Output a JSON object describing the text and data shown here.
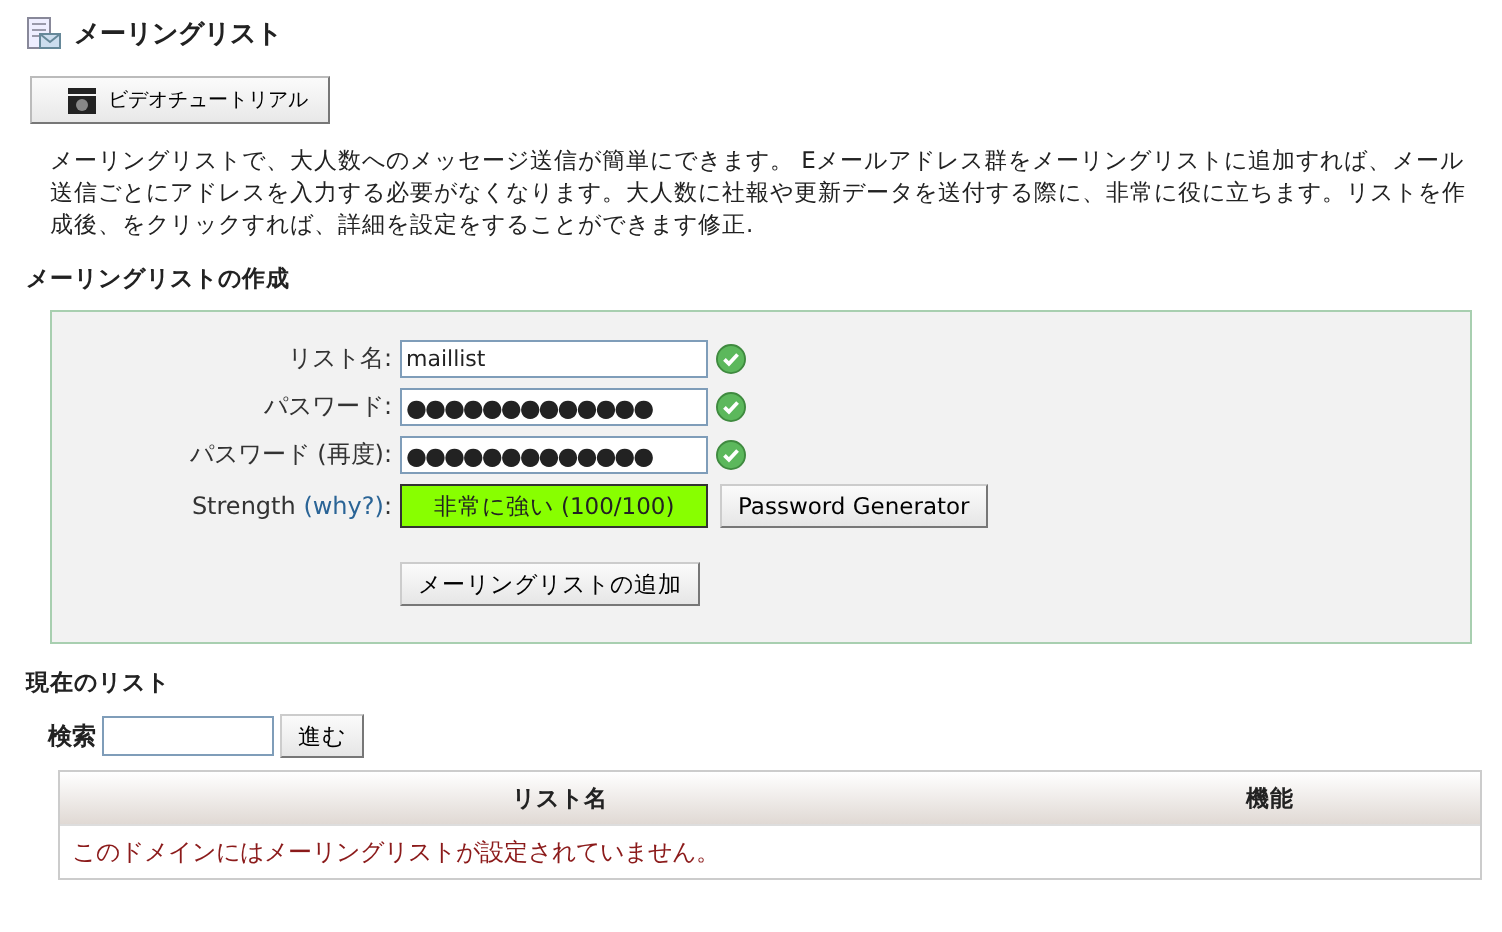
{
  "page": {
    "title": "メーリングリスト",
    "tutorial_button": "ビデオチュートリアル",
    "description": "メーリングリストで、大人数へのメッセージ送信が簡単にできます。 Eメールアドレス群をメーリングリストに追加すれば、メール送信ごとにアドレスを入力する必要がなくなります。大人数に社報や更新データを送付する際に、非常に役に立ちます。リストを作成後、をクリックすれば、詳細を設定をすることができます修正."
  },
  "create_section": {
    "heading": "メーリングリストの作成",
    "fields": [
      {
        "label": "リスト名:",
        "kind": "text",
        "value": "maillist",
        "valid": true
      },
      {
        "label": "パスワード:",
        "kind": "password",
        "value": "●●●●●●●●●●●●●",
        "valid": true
      },
      {
        "label": "パスワード (再度):",
        "kind": "password",
        "value": "●●●●●●●●●●●●●",
        "valid": true
      }
    ],
    "strength": {
      "label": "Strength",
      "link": "(why?)",
      "colon": ":",
      "reading": "非常に強い (100/100)",
      "level": 1
    },
    "generator_button": "Password Generator",
    "submit_button": "メーリングリストの追加"
  },
  "list_section": {
    "heading": "現在のリスト",
    "search_label": "検索",
    "go_button": "進む",
    "table": {
      "columns": [
        "リスト名",
        "機能"
      ],
      "empty_message": "このドメインにはメーリングリストが設定されていません。"
    }
  }
}
